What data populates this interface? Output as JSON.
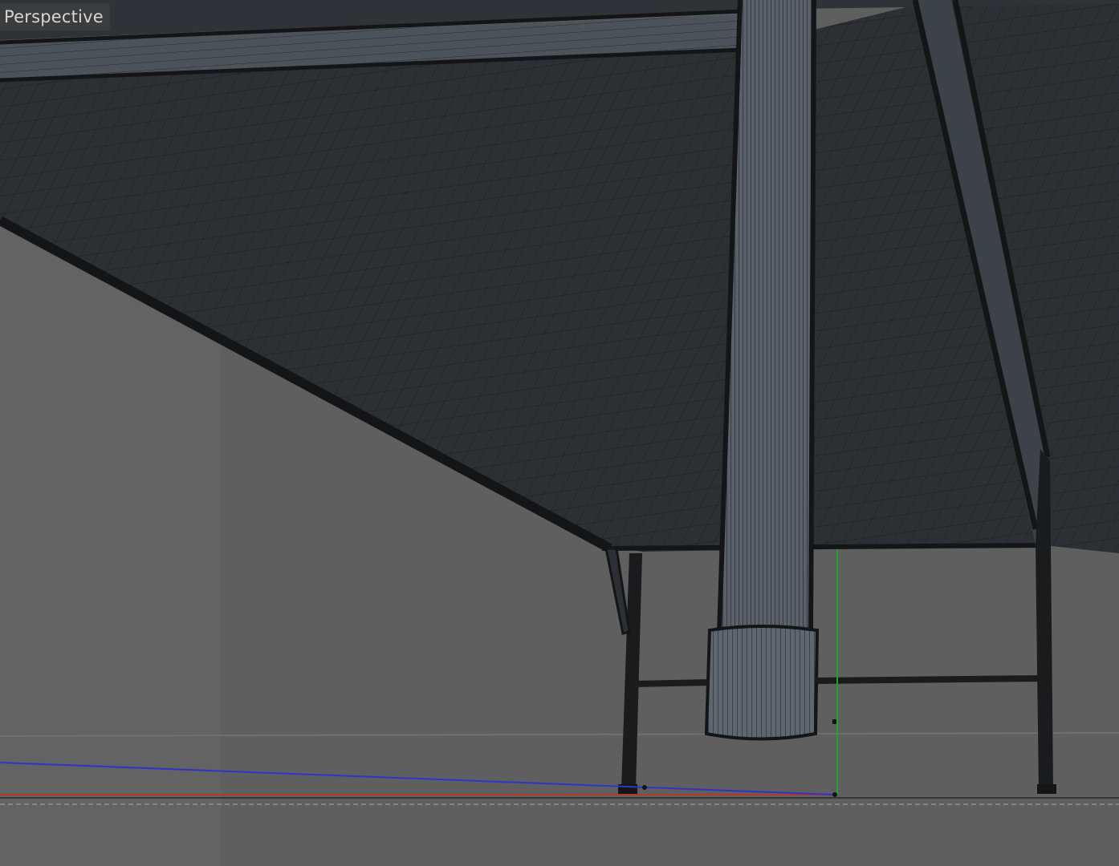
{
  "viewport": {
    "label": "Perspective",
    "background_color": "#5f5f5f",
    "mesh_fill_color": "#2c2f33",
    "wire_color": "#17181a",
    "axis_colors": {
      "x_axis": "#b33a2a",
      "y_axis": "#1fa61f",
      "z_axis": "#3232c8"
    }
  }
}
